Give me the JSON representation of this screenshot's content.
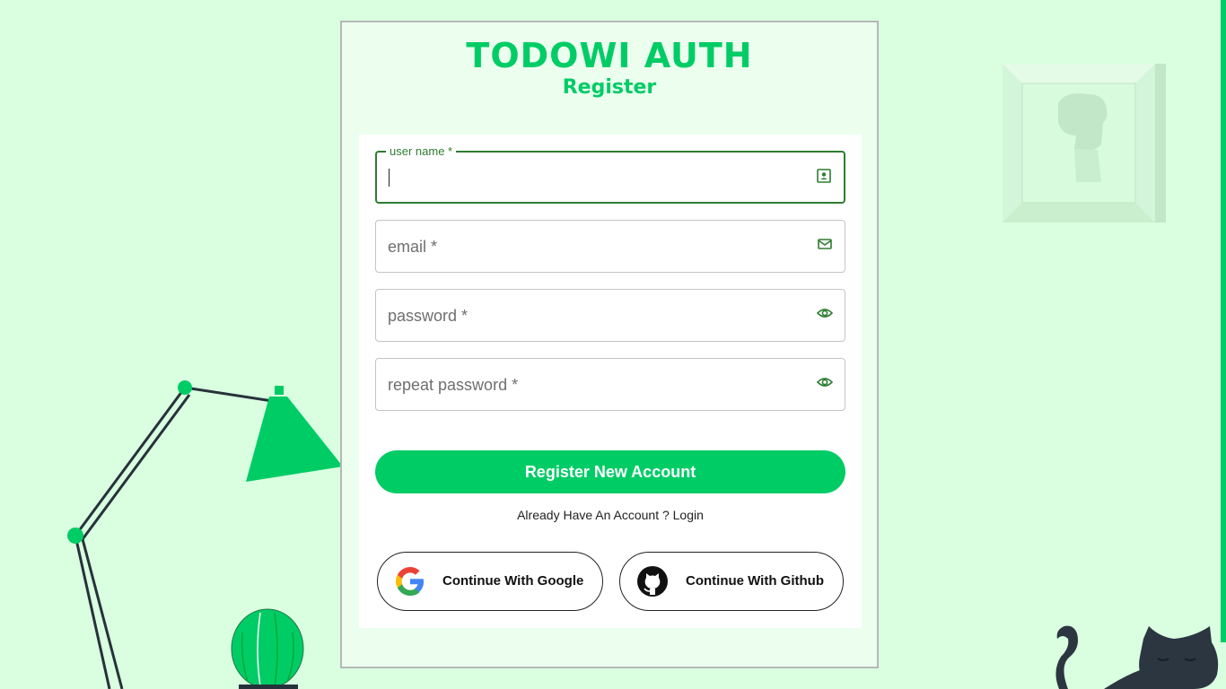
{
  "colors": {
    "accent": "#00cc66",
    "background": "#d9ffe0",
    "focus": "#2e7d32"
  },
  "header": {
    "brand": "TODOWI AUTH",
    "subtitle": "Register"
  },
  "form": {
    "username": {
      "label": "user name *",
      "value": "",
      "icon": "user-card-icon"
    },
    "email": {
      "placeholder": "email *",
      "icon": "mail-icon"
    },
    "password": {
      "placeholder": "password *",
      "icon": "eye-icon"
    },
    "repeat_password": {
      "placeholder": "repeat password *",
      "icon": "eye-icon"
    },
    "submit_label": "Register New Account",
    "login_prompt": "Already Have An Account ? Login"
  },
  "oauth": {
    "google_label": "Continue With Google",
    "github_label": "Continue With Github"
  }
}
